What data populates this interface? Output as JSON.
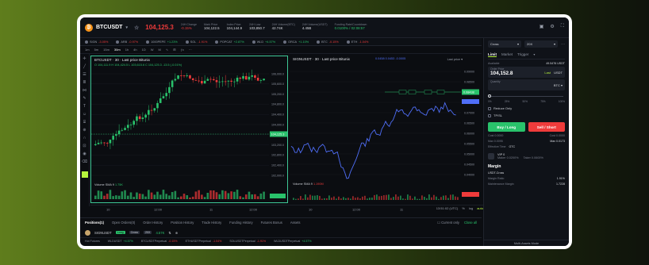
{
  "header": {
    "symbol": "BTCUSDT",
    "coin_glyph": "₿",
    "last_price": "104,125.3",
    "stats": [
      {
        "key": "24H Change",
        "value": "-0.15%",
        "tone": "red"
      },
      {
        "key": "Mark Price",
        "value": "104,122.5",
        "tone": ""
      },
      {
        "key": "Index Price",
        "value": "104,144.9",
        "tone": ""
      },
      {
        "key": "24H Low",
        "value": "103,850.7",
        "tone": ""
      },
      {
        "key": "24H Volume(BTC)",
        "value": "42.74K",
        "tone": ""
      },
      {
        "key": "24H Volume(USDT)",
        "value": "4.45B",
        "tone": ""
      },
      {
        "key": "Funding Rate/Countdown",
        "value": "0.0100% / 02:08:57",
        "tone": "green"
      }
    ]
  },
  "tickers": [
    {
      "name": "SIGN",
      "change": "-3.05%",
      "tone": "neg"
    },
    {
      "name": "ARB",
      "change": "-0.97%",
      "tone": "neg"
    },
    {
      "name": "1000PEPE",
      "change": "+1.23%",
      "tone": "pos"
    },
    {
      "name": "SOL",
      "change": "-1.91%",
      "tone": "neg"
    },
    {
      "name": "POPCAT",
      "change": "+2.87%",
      "tone": "pos"
    },
    {
      "name": "WLD",
      "change": "+4.57%",
      "tone": "pos"
    },
    {
      "name": "ORCA",
      "change": "+1.10%",
      "tone": "pos"
    },
    {
      "name": "BTC",
      "change": "-0.15%",
      "tone": "neg"
    },
    {
      "name": "ETH",
      "change": "-1.04%",
      "tone": "neg"
    }
  ],
  "chart_toolbar": [
    "1m",
    "5m",
    "15m",
    "30m",
    "1h",
    "4h",
    "1D",
    "W",
    "M",
    "∿",
    "⊞",
    "ƒx",
    "⋯"
  ],
  "chart_toolbar_selected": "30m",
  "chart_a": {
    "title": "BTCUSDT · 30 · Last price Bitunix",
    "ohlc": "O 104,111.9  H 104,424.5  L 103,615.6  C 104,125.3  -13.5 (-0.01%)",
    "volume_label": "Volume SMA 9",
    "volume_value": "1.75K",
    "y_ticks": [
      "106,000.0",
      "105,600.0",
      "105,200.0",
      "104,800.0",
      "104,400.0",
      "104,000.0",
      "103,600.0",
      "103,200.0",
      "102,800.0",
      "102,400.0",
      "102,000.0"
    ],
    "price_tag": "104,125.3",
    "x_ticks": [
      "10",
      "12:00",
      "11",
      "12:00"
    ]
  },
  "chart_b": {
    "title": "SIGNUSDT · 30 · Last price Bitunix",
    "ohlc_short": "0.0458  0.0453 -0.0005",
    "volume_label": "Volume SMA 9",
    "volume_value": "1.190M",
    "y_ticks": [
      "0.09000",
      "0.08500",
      "0.08000",
      "0.07500",
      "0.07000",
      "0.06500",
      "0.06000",
      "0.05500",
      "0.05000",
      "0.04500",
      "0.04000"
    ],
    "price_tag": "0.08438",
    "last_price_label": "Last price",
    "x_ticks": [
      "10",
      "12:00",
      "11",
      "12:00",
      "12"
    ],
    "time": "13:51:02 (UTC)",
    "scale_options": [
      "%",
      "log",
      "auto"
    ]
  },
  "bottom_tabs": {
    "tabs": [
      "Positions(1)",
      "Open Orders(0)",
      "Order History",
      "Position History",
      "Trade History",
      "Funding History",
      "Futures Bonus",
      "Assets"
    ],
    "active": "Positions(1)",
    "current_only": "Current only",
    "close_all": "Close all"
  },
  "position": {
    "symbol": "SIGNUSDT",
    "side": "Long",
    "margin_mode": "Cross",
    "leverage": "20X",
    "pnl": "4.57K",
    "tags": [
      "⇅",
      "⊕"
    ]
  },
  "favorites_strip": [
    {
      "name": "Hot Futures",
      "change": "",
      "tone": ""
    },
    {
      "name": "WLDUSDT",
      "change": "+4.57%",
      "tone": "pos"
    },
    {
      "name": "BTCUSDTPerpetual",
      "change": "-0.15%",
      "tone": "neg"
    },
    {
      "name": "ETHUSDTPerpetual",
      "change": "-1.04%",
      "tone": "neg"
    },
    {
      "name": "SOLUSDTPerpetual",
      "change": "-1.91%",
      "tone": "neg"
    },
    {
      "name": "WLDUSDTPerpetual",
      "change": "+4.57%",
      "tone": "pos"
    }
  ],
  "order_panel": {
    "margin_mode": "Cross",
    "leverage": "20X",
    "tabs": [
      "Limit",
      "Market",
      "Trigger"
    ],
    "active_tab": "Limit",
    "available_label": "Available",
    "available_value": "49.5476 USDT",
    "order_price_label": "Order Price",
    "order_price": "104,152.8",
    "last_label": "Last",
    "quote": "USDT",
    "quantity_label": "Quantity",
    "quantity_unit": "BTC",
    "slider_marks": [
      "0%",
      "25%",
      "50%",
      "75%",
      "100%"
    ],
    "slider_value_pct": 0,
    "reduce_only": "Reduce Only",
    "tpsl": "TP/SL",
    "buy_label": "Buy / Long",
    "sell_label": "Sell / Short",
    "cost_rows": [
      {
        "k": "Cost 0.0000",
        "v": "Cost 0.0000"
      },
      {
        "k": "Max 0.0095",
        "v": "Max 0.0173"
      }
    ],
    "time_in_force_label": "Effective Time",
    "time_in_force": "GTC",
    "vip_label": "VIP 0",
    "maker_fee": "Maker 0.0200%",
    "taker_fee": "Taker 0.0600%",
    "margin_title": "Margin",
    "margin_account": "USDT-Cross",
    "margin_ratio_label": "Margin Ratio",
    "margin_ratio": "1.91%",
    "maintenance_label": "Maintenance Margin",
    "maintenance": "1.7228",
    "multi_assets": "Multi-Assets Mode"
  },
  "colors": {
    "up": "#29c26b",
    "down": "#ef3b3b",
    "line": "#4f6ef7",
    "accent": "#b6f33d"
  }
}
